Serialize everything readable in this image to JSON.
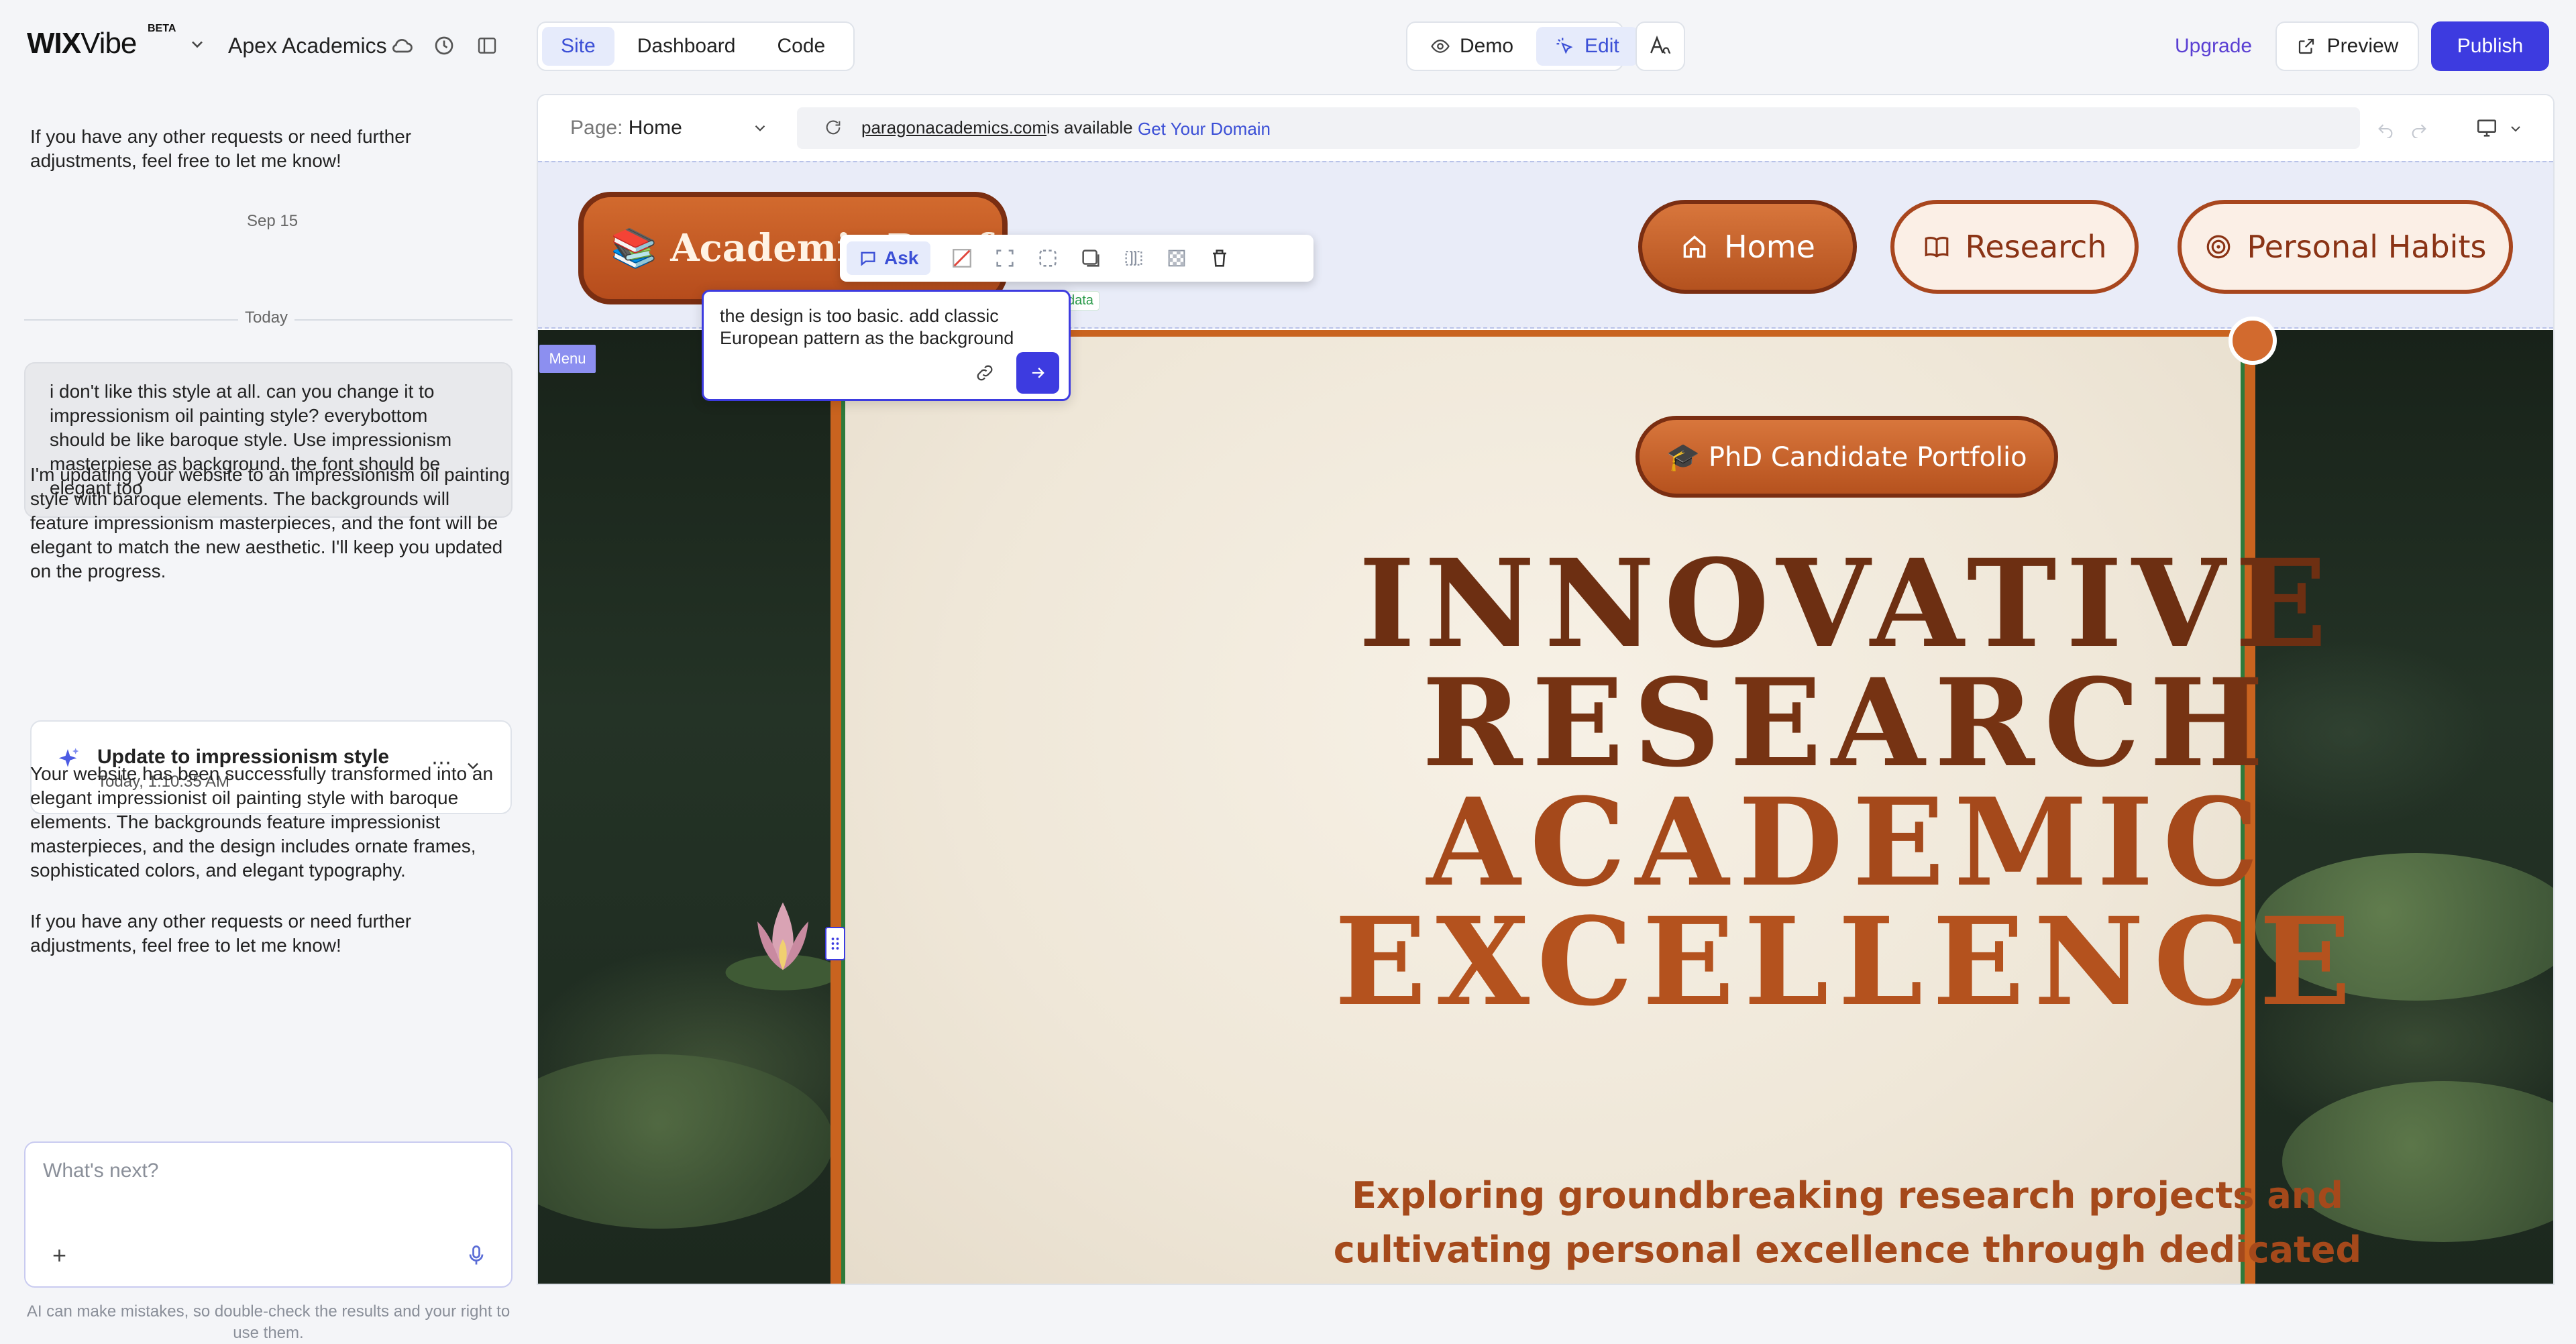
{
  "app": {
    "logo_wix": "WIX",
    "logo_vibe": "Vibe",
    "beta": "BETA",
    "project_name": "Apex Academics"
  },
  "topnav": {
    "tabs": [
      {
        "label": "Site",
        "active": true
      },
      {
        "label": "Dashboard",
        "active": false
      },
      {
        "label": "Code",
        "active": false
      }
    ],
    "mode_demo": "Demo",
    "mode_edit": "Edit",
    "upgrade": "Upgrade",
    "preview": "Preview",
    "publish": "Publish"
  },
  "chat": {
    "prev_message": "If you have any other requests or need further adjustments, feel free to let me know!",
    "date_label": "Sep 15",
    "today_label": "Today",
    "user_message": "i don't like this style at all. can you change it to impressionism oil painting style? everybottom should be like baroque style. Use impressionism masterpiese as background. the font should be elegant too",
    "assistant_message_1": "I'm updating your website to an impressionism oil painting style with baroque elements. The backgrounds will feature impressionism masterpieces, and the font will be elegant to match the new aesthetic. I'll keep you updated on the progress.",
    "task_title": "Update to impressionism style",
    "task_time": "Today, 1:10:35 AM",
    "assistant_message_2": "Your website has been successfully transformed into an elegant impressionist oil painting style with baroque elements. The backgrounds feature impressionist masterpieces, and the design includes ornate frames, sophisticated colors, and elegant typography.",
    "assistant_message_3": "If you have any other requests or need further adjustments, feel free to let me know!",
    "input_placeholder": "What's next?",
    "disclaimer": "AI can make mistakes, so double-check the results and your right to use them."
  },
  "editor": {
    "page_label": "Page:",
    "page_value": "Home",
    "domain": "paragonacademics.com",
    "domain_status": "is available",
    "domain_cta": "Get Your Domain",
    "toolbar_ask": "Ask",
    "prompt_text": "the design is too basic. add classic European pattern as the background",
    "data_tag": "data",
    "menu_tag": "Menu"
  },
  "site": {
    "brand": "📚 Academic Portfolio",
    "nav": [
      {
        "label": "Home",
        "icon": "home-icon"
      },
      {
        "label": "Research",
        "icon": "book-icon"
      },
      {
        "label": "Personal Habits",
        "icon": "target-icon"
      }
    ],
    "phd_pill": "🎓 PhD Candidate Portfolio",
    "headline": [
      "INNOVATIVE",
      "RESEARCH",
      "ACADEMIC",
      "EXCELLENCE"
    ],
    "subtitle": "Exploring groundbreaking research projects and cultivating personal excellence through dedicated academic pursuit and innovative thinking. ✨"
  },
  "colors": {
    "accent": "#3d3be0",
    "brand_orange": "#c9631f",
    "headline_dark": "#6d2f12",
    "headline_light": "#b4521e"
  }
}
